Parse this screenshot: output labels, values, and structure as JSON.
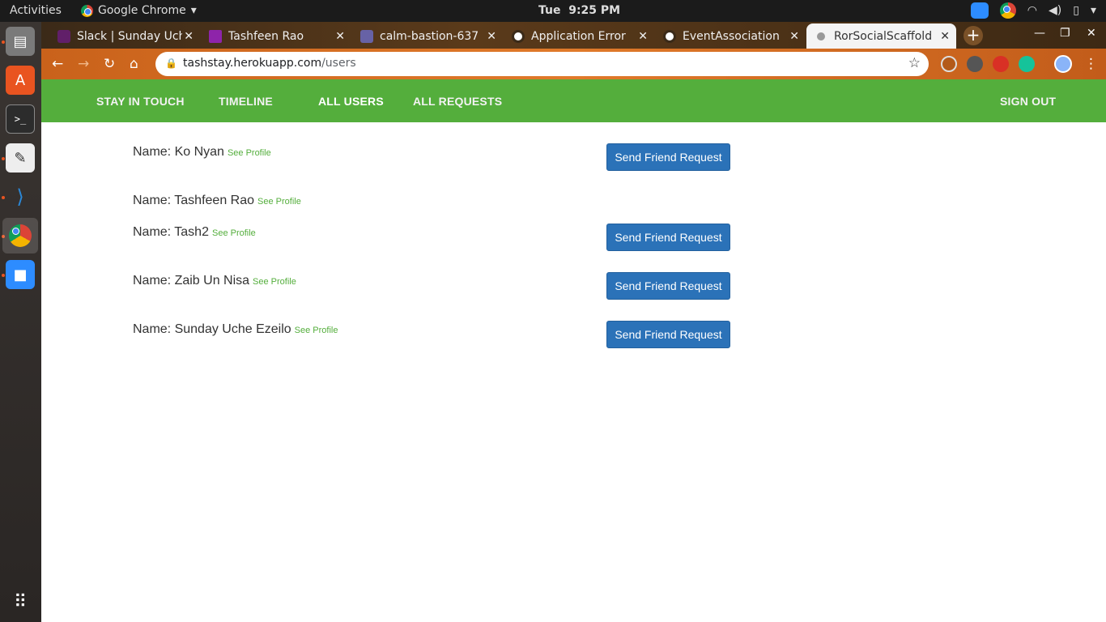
{
  "topbar": {
    "activities": "Activities",
    "app_name": "Google Chrome",
    "clock": "Tue  9:25 PM"
  },
  "tabs": [
    {
      "label": "Slack | Sunday Uch",
      "color": "#4a154b"
    },
    {
      "label": "Tashfeen Rao",
      "color": "#8e24aa"
    },
    {
      "label": "calm-bastion-637",
      "color": "#6762a6"
    },
    {
      "label": "Application Error",
      "color": "#ffffff"
    },
    {
      "label": "EventAssociation",
      "color": "#ffffff"
    },
    {
      "label": "RorSocialScaffold",
      "color": "#888888"
    }
  ],
  "address": {
    "host": "tashstay.herokuapp.com",
    "path": "/users"
  },
  "nav": {
    "stay_in_touch": "STAY IN TOUCH",
    "timeline": "TIMELINE",
    "all_users": "ALL USERS",
    "all_requests": "ALL REQUESTS",
    "sign_out": "SIGN OUT"
  },
  "users": [
    {
      "name": "Name: Ko Nyan",
      "link": "See Profile",
      "button": "Send Friend Request"
    },
    {
      "name": "Name: Tashfeen Rao",
      "link": "See Profile"
    },
    {
      "name": "Name: Tash2",
      "link": "See Profile",
      "button": "Send Friend Request"
    },
    {
      "name": "Name: Zaib Un Nisa",
      "link": "See Profile",
      "button": "Send Friend Request"
    },
    {
      "name": "Name: Sunday Uche Ezeilo",
      "link": "See Profile",
      "button": "Send Friend Request"
    }
  ],
  "colors": {
    "navbar": "#54ae3c",
    "button": "#2b72b8",
    "link": "#54ae3c"
  }
}
